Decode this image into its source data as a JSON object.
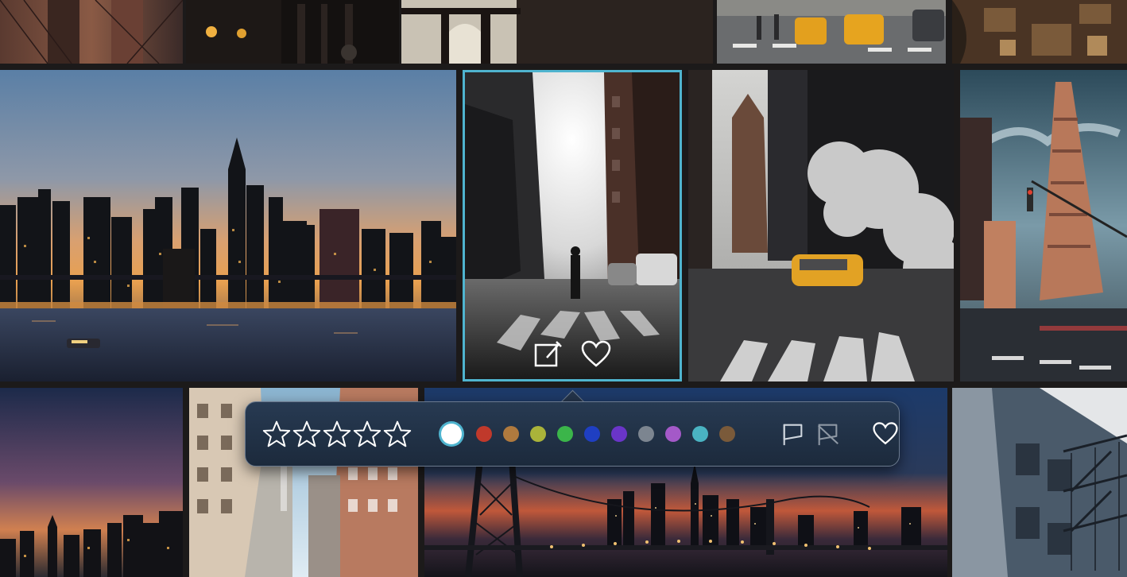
{
  "app": {
    "accent": "#4fb4cf",
    "background": "#1c1a1a"
  },
  "gallery": {
    "photos": [
      {
        "name": "brooklyn-bridge-cables",
        "row": 1
      },
      {
        "name": "dark-street-lamps",
        "row": 1
      },
      {
        "name": "manhattan-bridge-arch",
        "row": 1
      },
      {
        "name": "taxi-crosswalk",
        "row": 1
      },
      {
        "name": "rooftops-aerial",
        "row": 1
      },
      {
        "name": "skyline-sunset-river",
        "row": 2
      },
      {
        "name": "street-person-fog",
        "row": 2,
        "selected": true
      },
      {
        "name": "steam-taxi-street",
        "row": 2
      },
      {
        "name": "flatiron-building",
        "row": 2
      },
      {
        "name": "skyline-dusk",
        "row": 3
      },
      {
        "name": "building-canyon",
        "row": 3
      },
      {
        "name": "bridge-night-skyline",
        "row": 3
      },
      {
        "name": "fire-escapes",
        "row": 3
      }
    ],
    "selected_photo": {
      "actions": [
        "edit-icon",
        "heart-icon"
      ]
    }
  },
  "toolbar": {
    "rating": {
      "max": 5,
      "value": 0
    },
    "colors": [
      {
        "name": "none",
        "hex": "#ffffff",
        "selected": true
      },
      {
        "name": "red",
        "hex": "#c0392b"
      },
      {
        "name": "orange",
        "hex": "#b07a3e"
      },
      {
        "name": "yellow",
        "hex": "#aab33a"
      },
      {
        "name": "green",
        "hex": "#3bb54a"
      },
      {
        "name": "blue",
        "hex": "#1f3fc2"
      },
      {
        "name": "purple",
        "hex": "#6a35c8"
      },
      {
        "name": "gray",
        "hex": "#7c8590"
      },
      {
        "name": "violet",
        "hex": "#a459c8"
      },
      {
        "name": "teal",
        "hex": "#4ab3c2"
      },
      {
        "name": "brown",
        "hex": "#7a5a3a"
      }
    ],
    "flags": [
      "flag-icon",
      "unflag-icon"
    ],
    "favorite": "heart-icon"
  }
}
